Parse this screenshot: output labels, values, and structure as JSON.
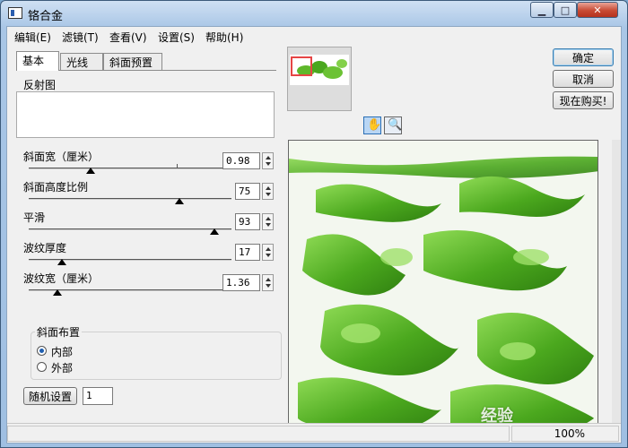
{
  "window": {
    "title": "铬合金",
    "icon": "app-window-icon",
    "controls": {
      "minimize": "minimize-icon",
      "maximize": "maximize-icon",
      "close": "close-icon"
    }
  },
  "menu": [
    "编辑(E)",
    "滤镜(T)",
    "查看(V)",
    "设置(S)",
    "帮助(H)"
  ],
  "tabs": [
    "基本",
    "光线",
    "斜面预置"
  ],
  "basic": {
    "reflection_label": "反射图",
    "sliders": [
      {
        "label": "斜面宽（厘米）",
        "value": "0.98",
        "position": 0.39
      },
      {
        "label": "斜面高度比例",
        "value": "75",
        "position": 0.75
      },
      {
        "label": "平滑",
        "value": "93",
        "position": 0.93
      },
      {
        "label": "波纹厚度",
        "value": "17",
        "position": 0.17
      },
      {
        "label": "波纹宽（厘米）",
        "value": "1.36",
        "position": 0.16
      }
    ],
    "bevel_group": {
      "title": "斜面布置",
      "options": [
        {
          "label": "内部",
          "selected": true
        },
        {
          "label": "外部",
          "selected": false
        }
      ]
    },
    "random_button": "随机设置",
    "random_value": "1"
  },
  "actions": {
    "ok": "确定",
    "cancel": "取消",
    "buy": "现在购买!"
  },
  "tools": {
    "hand": "hand-icon",
    "zoom": "magnifier-icon"
  },
  "status": {
    "zoom": "100%"
  },
  "colors": {
    "accent": "#3c7fb1",
    "preview_green": "#59b31f",
    "close": "#c84a33"
  },
  "watermark": "经验"
}
